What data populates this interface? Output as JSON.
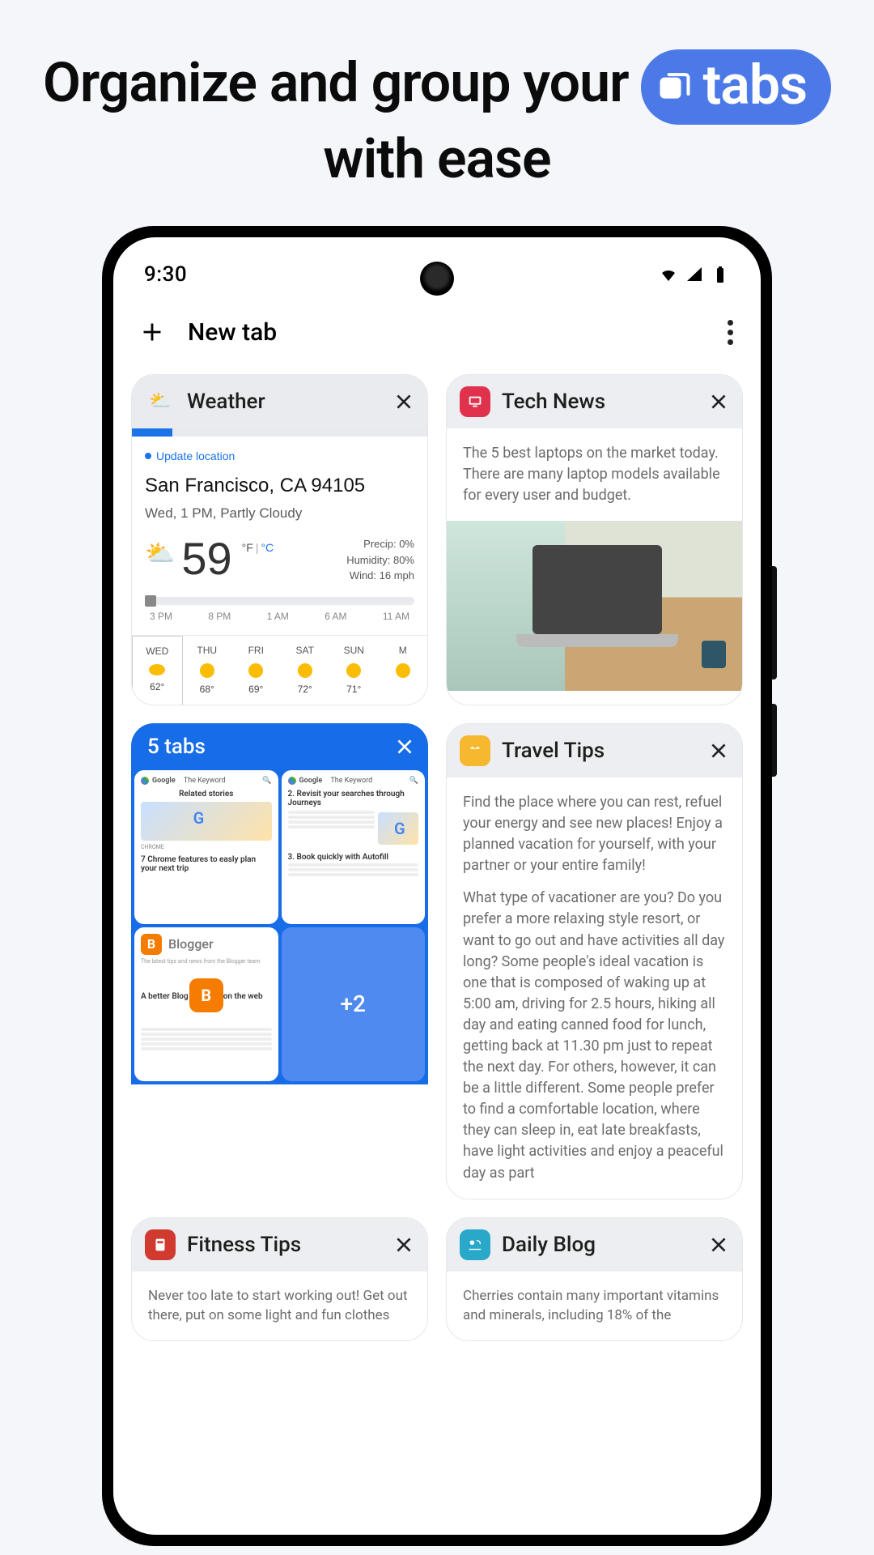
{
  "headline": {
    "pre": "Organize and group your ",
    "pill": "tabs",
    "post": " with ease"
  },
  "status": {
    "time": "9:30"
  },
  "header": {
    "new_tab": "New tab"
  },
  "tabs": {
    "weather": {
      "title": "Weather",
      "update": "Update location",
      "location": "San Francisco, CA 94105",
      "when": "Wed, 1 PM, Partly Cloudy",
      "temp": "59",
      "unit_f": "°F",
      "unit_c": "°C",
      "stats": {
        "precip": "Precip: 0%",
        "humidity": "Humidity: 80%",
        "wind": "Wind: 16 mph"
      },
      "hours": [
        "3 PM",
        "8 PM",
        "1 AM",
        "6 AM",
        "11 AM"
      ],
      "days": [
        {
          "label": "WED",
          "temp": "62°",
          "today": true,
          "icon": "cloud"
        },
        {
          "label": "THU",
          "temp": "68°",
          "icon": "sun"
        },
        {
          "label": "FRI",
          "temp": "69°",
          "icon": "sun"
        },
        {
          "label": "SAT",
          "temp": "72°",
          "icon": "sun"
        },
        {
          "label": "SUN",
          "temp": "71°",
          "icon": "sun"
        },
        {
          "label": "M",
          "temp": "",
          "icon": "sun"
        }
      ]
    },
    "tech": {
      "title": "Tech News",
      "blurb": "The 5 best laptops on the market today. There are many laptop models available for every user and budget."
    },
    "group": {
      "title": "5 tabs",
      "more": "+2",
      "mini1": {
        "brand": "Google",
        "tag": "The Keyword",
        "headline": "Related stories",
        "label": "CHROME",
        "line": "7 Chrome features to easly plan your next trip"
      },
      "mini2": {
        "brand": "Google",
        "tag": "The Keyword",
        "h2": "2. Revisit your searches through Journeys",
        "h3": "3. Book quickly with Autofill"
      },
      "mini3": {
        "name": "Blogger",
        "sub": "The latest tips and news from the Blogger team",
        "hl": "A better Blog",
        "hr": "on the web"
      }
    },
    "travel": {
      "title": "Travel Tips",
      "p1": "Find the place where you can rest, refuel your energy and see new places! Enjoy a planned vacation for yourself, with your partner or your entire family!",
      "p2": "What type of vacationer are you? Do you prefer a more relaxing style resort, or want to go out and have activities all day long? Some people's ideal vacation is one that is composed of waking up at 5:00 am, driving for 2.5 hours, hiking all day and eating canned food for lunch, getting back at 11.30 pm just to repeat the next day. For others, however, it can be a little different. Some people prefer to find a comfortable location, where they can sleep in, eat late breakfasts, have light activities and enjoy a peaceful day as part"
    },
    "fitness": {
      "title": "Fitness Tips",
      "blurb": "Never too late to start working out! Get out there, put on some light and fun clothes"
    },
    "blog": {
      "title": "Daily Blog",
      "blurb": "Cherries contain many important vitamins and minerals, including 18% of the"
    }
  }
}
